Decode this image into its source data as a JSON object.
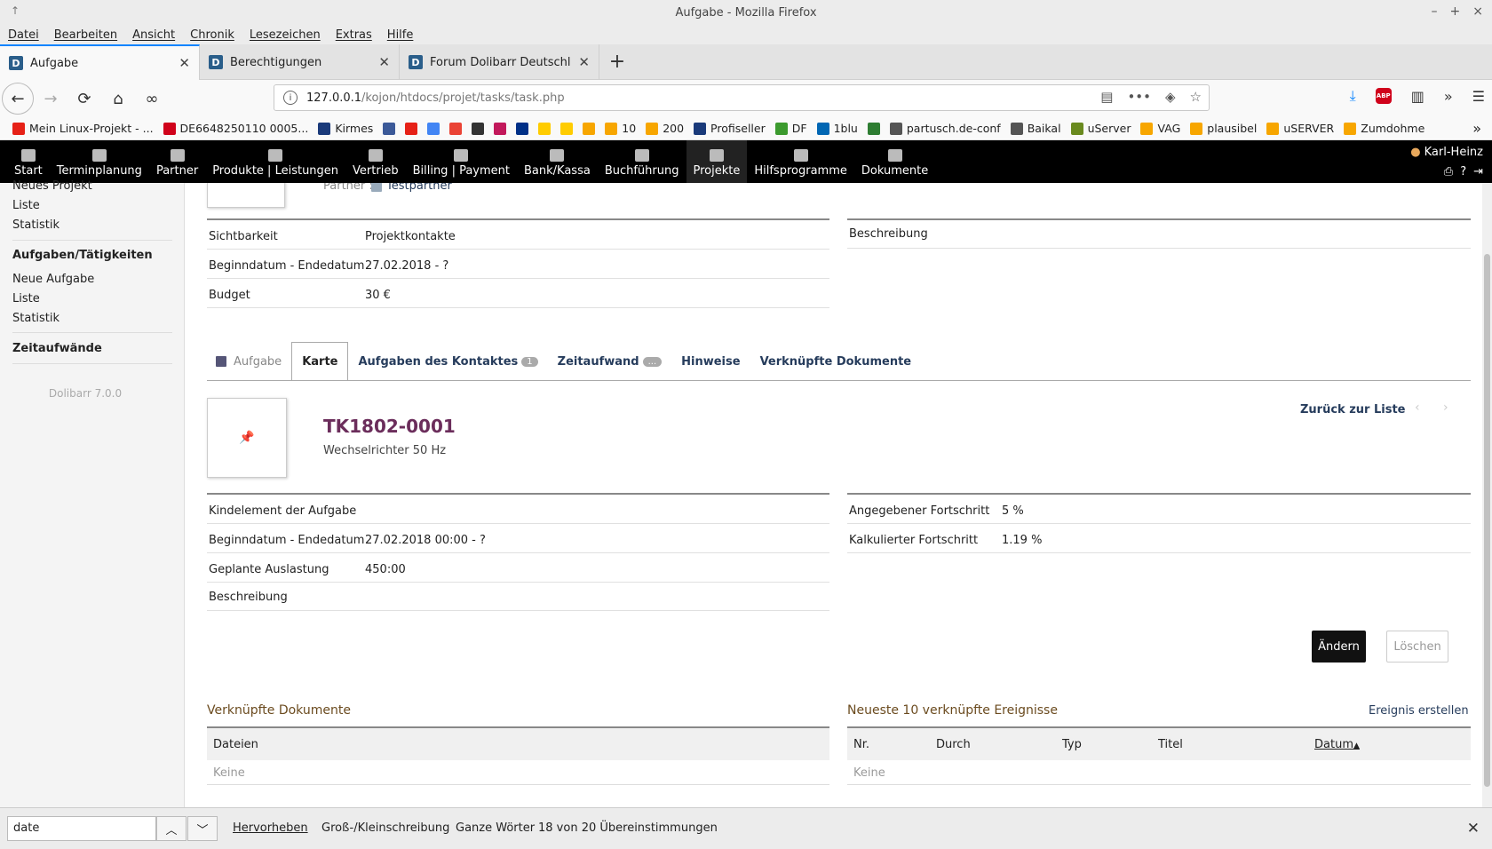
{
  "window": {
    "title": "Aufgabe - Mozilla Firefox"
  },
  "menubar": [
    "Datei",
    "Bearbeiten",
    "Ansicht",
    "Chronik",
    "Lesezeichen",
    "Extras",
    "Hilfe"
  ],
  "tabs": [
    {
      "label": "Aufgabe"
    },
    {
      "label": "Berechtigungen"
    },
    {
      "label": "Forum Dolibarr Deutschland"
    }
  ],
  "url": {
    "host": "127.0.0.1",
    "path": "/kojon/htdocs/projet/tasks/task.php"
  },
  "bookmarks": [
    {
      "label": "Mein Linux-Projekt - ...",
      "color": "#e62117"
    },
    {
      "label": "DE6648250110 0005...",
      "color": "#d0021b"
    },
    {
      "label": "Kirmes",
      "color": "#1a3a7a"
    },
    {
      "label": "",
      "color": "#3b5998"
    },
    {
      "label": "",
      "color": "#e62117"
    },
    {
      "label": "",
      "color": "#4285f4"
    },
    {
      "label": "",
      "color": "#ea4335"
    },
    {
      "label": "",
      "color": "#333333"
    },
    {
      "label": "",
      "color": "#c2185b"
    },
    {
      "label": "",
      "color": "#003087"
    },
    {
      "label": "",
      "color": "#ffcc00"
    },
    {
      "label": "",
      "color": "#ffcc00"
    },
    {
      "label": "",
      "color": "#f7a600"
    },
    {
      "label": "10",
      "color": "#f7a600"
    },
    {
      "label": "200",
      "color": "#f7a600"
    },
    {
      "label": "Profiseller",
      "color": "#1a3a7a"
    },
    {
      "label": "DF",
      "color": "#3c9a2e"
    },
    {
      "label": "1blu",
      "color": "#0066b3"
    },
    {
      "label": "",
      "color": "#2e7d32"
    },
    {
      "label": "partusch.de-conf",
      "color": "#555555"
    },
    {
      "label": "Baikal",
      "color": "#555555"
    },
    {
      "label": "uServer",
      "color": "#6a8a1f"
    },
    {
      "label": "VAG",
      "color": "#f7a600"
    },
    {
      "label": "plausibel",
      "color": "#f7a600"
    },
    {
      "label": "uSERVER",
      "color": "#f7a600"
    },
    {
      "label": "Zumdohme",
      "color": "#f7a600"
    }
  ],
  "topmenu": {
    "items": [
      "Start",
      "Terminplanung",
      "Partner",
      "Produkte | Leistungen",
      "Vertrieb",
      "Billing | Payment",
      "Bank/Kassa",
      "Buchführung",
      "Projekte",
      "Hilfsprogramme",
      "Dokumente"
    ],
    "user": "Karl-Heinz"
  },
  "sidebar": {
    "new_project": "Neues Projekt",
    "list1": "Liste",
    "stats1": "Statistik",
    "tasks_head": "Aufgaben/Tätigkeiten",
    "new_task": "Neue Aufgabe",
    "list2": "Liste",
    "stats2": "Statistik",
    "time_head": "Zeitaufwände",
    "version": "Dolibarr 7.0.0"
  },
  "project": {
    "partner_label": "Partner :",
    "partner_value": "Testpartner",
    "rows": [
      {
        "label": "Sichtbarkeit",
        "value": "Projektkontakte"
      },
      {
        "label": "Beginndatum - Endedatum",
        "value": "27.02.2018 - ?"
      },
      {
        "label": "Budget",
        "value": "30 €"
      }
    ],
    "description_label": "Beschreibung"
  },
  "tabs2": {
    "first": "Aufgabe",
    "card": "Karte",
    "contact_tasks": "Aufgaben des Kontaktes",
    "contact_tasks_count": "1",
    "time": "Zeitaufwand",
    "time_badge": "...",
    "notes": "Hinweise",
    "docs": "Verknüpfte Dokumente"
  },
  "task": {
    "ref": "TK1802-0001",
    "label": "Wechselrichter 50 Hz",
    "back": "Zurück zur Liste",
    "left_rows": [
      {
        "label": "Kindelement der Aufgabe",
        "value": ""
      },
      {
        "label": "Beginndatum - Endedatum",
        "value": "27.02.2018 00:00 - ?"
      },
      {
        "label": "Geplante Auslastung",
        "value": "450:00"
      },
      {
        "label": "Beschreibung",
        "value": ""
      }
    ],
    "right_rows": [
      {
        "label": "Angegebener Fortschritt",
        "value": "5 %"
      },
      {
        "label": "Kalkulierter Fortschritt",
        "value": "1.19 %"
      }
    ]
  },
  "actions": {
    "modify": "Ändern",
    "delete": "Löschen"
  },
  "linked_docs": {
    "title": "Verknüpfte Dokumente",
    "col": "Dateien",
    "empty": "Keine"
  },
  "events": {
    "title": "Neueste 10 verknüpfte Ereignisse",
    "create": "Ereignis erstellen",
    "cols": [
      "Nr.",
      "Durch",
      "Typ",
      "Titel",
      "Datum"
    ],
    "empty": "Keine"
  },
  "findbar": {
    "query": "date",
    "highlight": "Hervorheben",
    "case": "Groß-/Kleinschreibung",
    "whole": "Ganze Wörter",
    "status": "18 von 20 Übereinstimmungen"
  }
}
